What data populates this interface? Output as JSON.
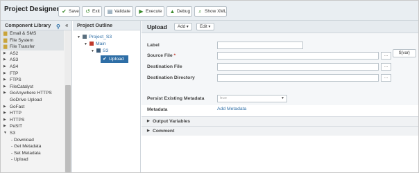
{
  "app_title": "Project Designer",
  "toolbar": {
    "save": "Save",
    "exit": "Exit",
    "validate": "Validate",
    "execute": "Execute",
    "debug": "Debug",
    "show_xml": "Show XML"
  },
  "library": {
    "title": "Component Library",
    "items": [
      {
        "label": "Email & SMS",
        "kind": "folder"
      },
      {
        "label": "File System",
        "kind": "folder"
      },
      {
        "label": "File Transfer",
        "kind": "folder-open"
      },
      {
        "label": "AS2",
        "kind": "collapsed"
      },
      {
        "label": "AS3",
        "kind": "collapsed"
      },
      {
        "label": "AS4",
        "kind": "collapsed"
      },
      {
        "label": "FTP",
        "kind": "collapsed"
      },
      {
        "label": "FTPS",
        "kind": "collapsed"
      },
      {
        "label": "FileCatalyst",
        "kind": "collapsed"
      },
      {
        "label": "GoAnywhere HTTPS",
        "kind": "collapsed"
      },
      {
        "label": "GoDrive Upload",
        "kind": "leaf"
      },
      {
        "label": "GoFast",
        "kind": "collapsed"
      },
      {
        "label": "HTTP",
        "kind": "collapsed"
      },
      {
        "label": "HTTPS",
        "kind": "collapsed"
      },
      {
        "label": "PeSIT",
        "kind": "collapsed"
      },
      {
        "label": "S3",
        "kind": "expanded"
      },
      {
        "label": "- Download",
        "kind": "sub"
      },
      {
        "label": "- Get Metadata",
        "kind": "sub"
      },
      {
        "label": "- Set Metadata",
        "kind": "sub"
      },
      {
        "label": "- Upload",
        "kind": "sub"
      }
    ]
  },
  "outline": {
    "title": "Project Outline",
    "project": "Project_S3",
    "module": "Main",
    "task": "S3",
    "selected": "Upload"
  },
  "editor": {
    "title": "Upload",
    "add_label": "Add",
    "edit_label": "Edit",
    "fields": {
      "label": "Label",
      "source_file": "Source File",
      "destination_file": "Destination File",
      "destination_directory": "Destination Directory",
      "persist_metadata": "Persist Existing Metadata",
      "metadata": "Metadata"
    },
    "persist_value": "true",
    "browse": "...",
    "var_button": "${var}",
    "add_metadata": "Add Metadata",
    "sections": [
      "Output Variables",
      "Comment"
    ]
  }
}
